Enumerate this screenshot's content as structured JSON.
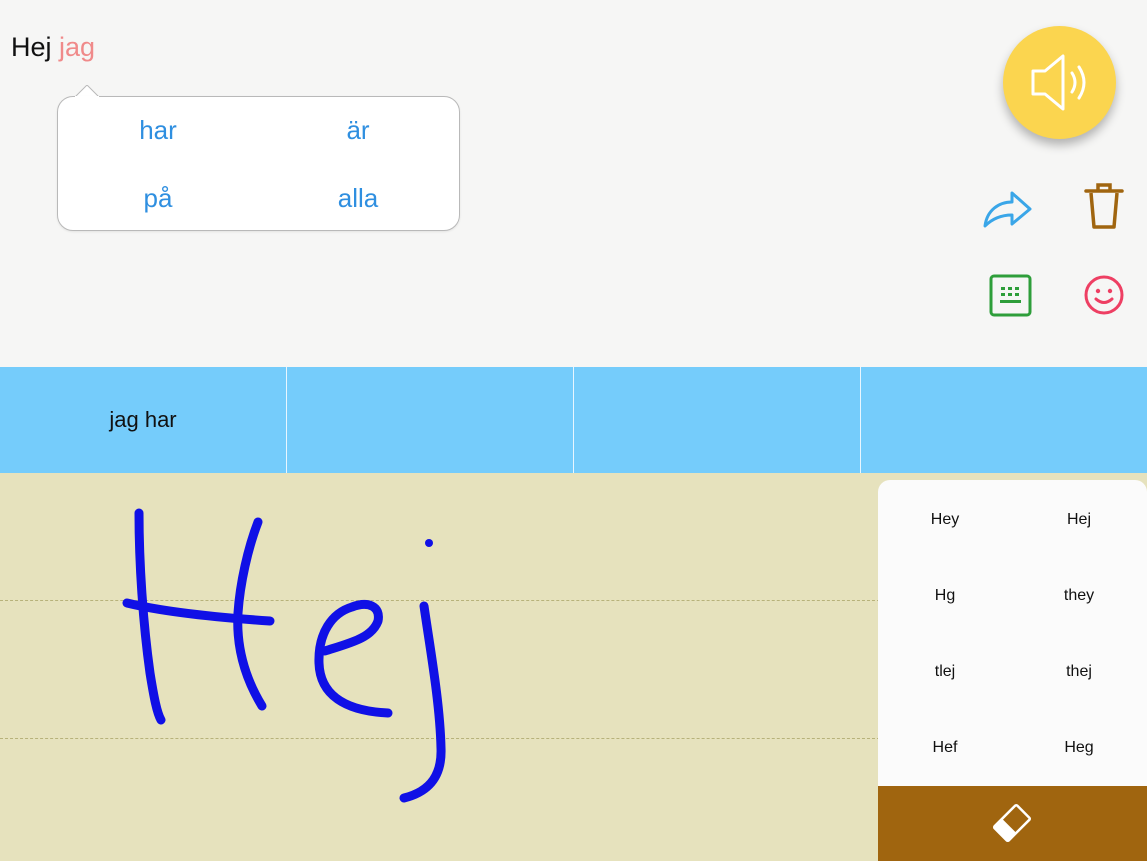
{
  "composer": {
    "confirmed_text": "Hej",
    "pending_text": "jag"
  },
  "word_suggestions": [
    "har",
    "är",
    "på",
    "alla"
  ],
  "actions": {
    "speak_icon": "speaker-icon",
    "share_icon": "share-arrow-icon",
    "delete_icon": "trash-icon",
    "keyboard_icon": "keyboard-icon",
    "emoji_icon": "smiley-icon"
  },
  "phrase_bar": [
    "jag har",
    "",
    "",
    ""
  ],
  "handwriting_candidates": [
    "Hey",
    "Hej",
    "Hg",
    "they",
    "tlej",
    "thej",
    "Hef",
    "Heg"
  ],
  "eraser_icon": "eraser-icon",
  "colors": {
    "accent_blue": "#2f8fe0",
    "pending_pink": "#f08a8a",
    "speak_yellow": "#fbd54f",
    "phrase_bar_blue": "#75ccfb",
    "paper": "#e6e2bd",
    "ink": "#1010e6",
    "eraser_brown": "#a0650f"
  }
}
